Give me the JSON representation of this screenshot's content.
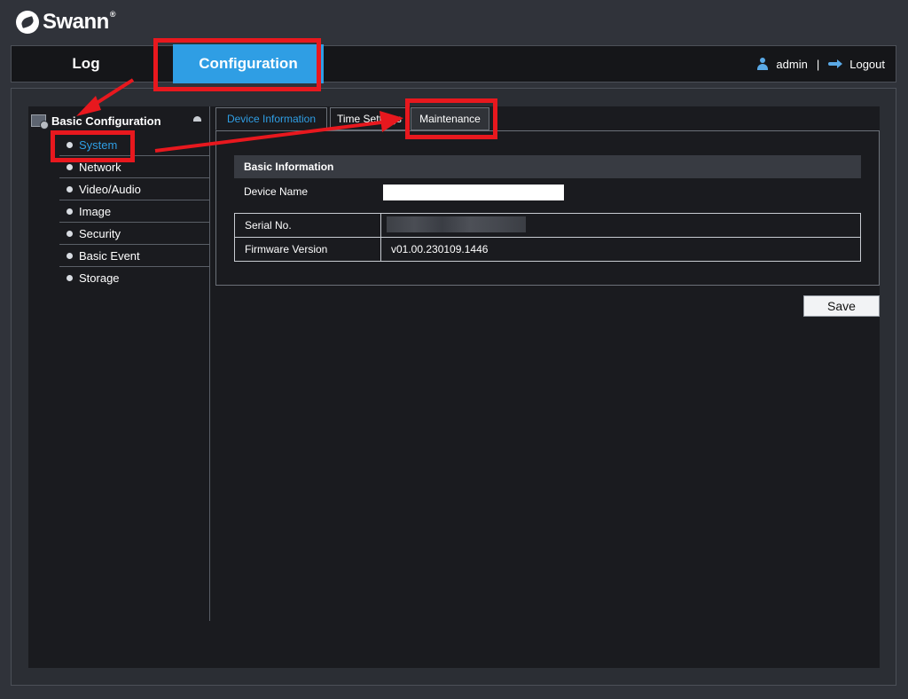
{
  "brand": {
    "name": "Swann",
    "trademark": "®"
  },
  "topnav": {
    "log_label": "Log",
    "configuration_label": "Configuration",
    "user": "admin",
    "separator": "|",
    "logout_label": "Logout"
  },
  "sidebar": {
    "header": "Basic Configuration",
    "items": [
      {
        "label": "System",
        "active": true
      },
      {
        "label": "Network"
      },
      {
        "label": "Video/Audio"
      },
      {
        "label": "Image"
      },
      {
        "label": "Security"
      },
      {
        "label": "Basic Event"
      },
      {
        "label": "Storage"
      }
    ]
  },
  "tabs": {
    "device_info": "Device Information",
    "time_settings": "Time Settings",
    "maintenance": "Maintenance"
  },
  "basic_info": {
    "header": "Basic Information",
    "device_name_label": "Device Name",
    "device_name_value": "",
    "serial_label": "Serial No.",
    "serial_value": "",
    "firmware_label": "Firmware Version",
    "firmware_value": "v01.00.230109.1446"
  },
  "save_label": "Save",
  "colors": {
    "accent_blue": "#2f9ee4",
    "highlight_red": "#e8181e",
    "background": "#30333a",
    "panel": "#1a1b1f"
  }
}
